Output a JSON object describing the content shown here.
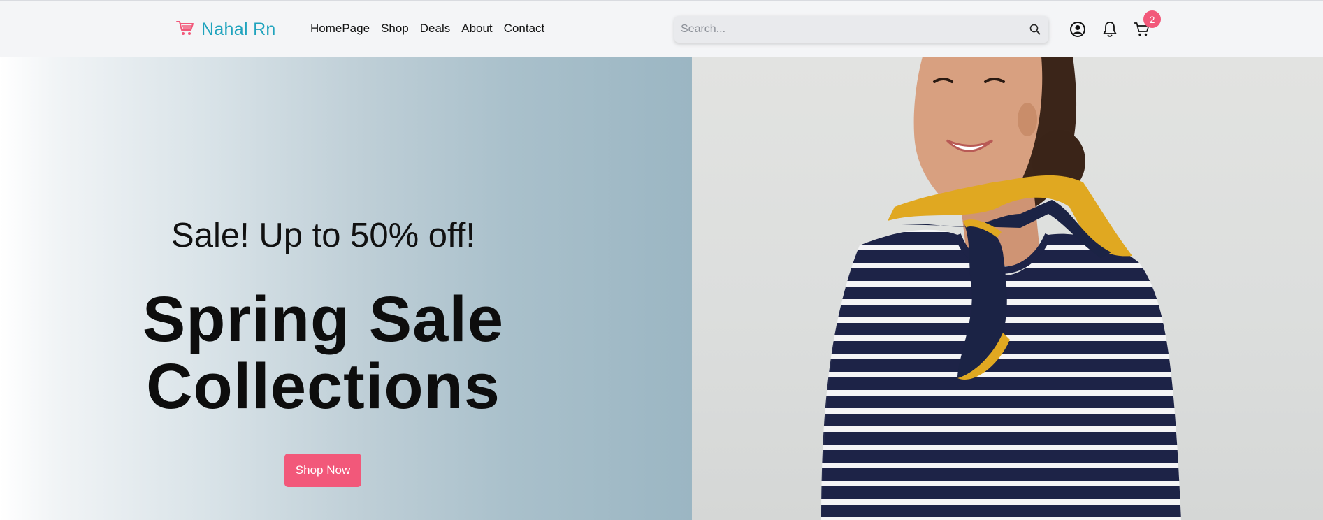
{
  "brand": {
    "name": "Nahal Rn",
    "logo_icon": "cart-icon",
    "color": "#1fa3bd",
    "logo_color": "#f2587a"
  },
  "nav": {
    "items": [
      {
        "label": "HomePage"
      },
      {
        "label": "Shop"
      },
      {
        "label": "Deals"
      },
      {
        "label": "About"
      },
      {
        "label": "Contact"
      }
    ]
  },
  "search": {
    "placeholder": "Search...",
    "value": "",
    "icon": "search-icon"
  },
  "actions": {
    "account_icon": "user-circle-icon",
    "notifications_icon": "bell-icon",
    "cart_icon": "cart-icon",
    "cart_count": "2"
  },
  "hero": {
    "sale_text": "Sale! Up to 50% off!",
    "title_line1": "Spring Sale",
    "title_line2": "Collections",
    "button_label": "Shop Now",
    "image_description": "woman in navy and white striped top with yellow and navy neck scarf",
    "accent_color": "#f2587a"
  }
}
